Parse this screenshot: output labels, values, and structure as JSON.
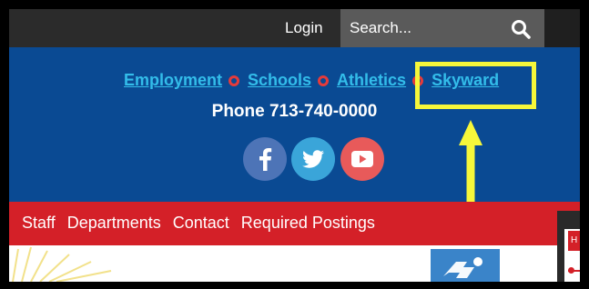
{
  "topbar": {
    "login_label": "Login",
    "search_placeholder": "Search...",
    "search_icon": "search-icon"
  },
  "links": [
    {
      "label": "Employment"
    },
    {
      "label": "Schools"
    },
    {
      "label": "Athletics"
    },
    {
      "label": "Skyward"
    }
  ],
  "phone": "Phone 713-740-0000",
  "social": [
    {
      "name": "facebook-icon",
      "glyph": "f",
      "color": "#4d74b7"
    },
    {
      "name": "twitter-icon",
      "color": "#3aa5d9"
    },
    {
      "name": "youtube-icon",
      "color": "#e85a5a"
    }
  ],
  "nav": {
    "items": [
      {
        "label": "Staff"
      },
      {
        "label": "Departments"
      },
      {
        "label": "Contact"
      },
      {
        "label": "Required Postings"
      }
    ]
  },
  "side_panel": {
    "tab_label": "H"
  },
  "colors": {
    "topbar": "#2b2b2b",
    "blue_header": "#0a4a93",
    "link": "#33bdea",
    "separator": "#e53b3b",
    "red_nav": "#d42028",
    "highlight": "#f6f73a"
  }
}
